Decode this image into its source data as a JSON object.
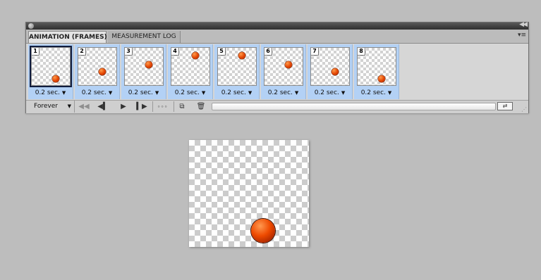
{
  "panel": {
    "tabs": [
      {
        "label": "ANIMATION (FRAMES)",
        "active": true
      },
      {
        "label": "MEASUREMENT LOG",
        "active": false
      }
    ],
    "frames": [
      {
        "number": "1",
        "delay": "0.2 sec.",
        "selected": true
      },
      {
        "number": "2",
        "delay": "0.2 sec.",
        "selected": false
      },
      {
        "number": "3",
        "delay": "0.2 sec.",
        "selected": false
      },
      {
        "number": "4",
        "delay": "0.2 sec.",
        "selected": false
      },
      {
        "number": "5",
        "delay": "0.2 sec.",
        "selected": false
      },
      {
        "number": "6",
        "delay": "0.2 sec.",
        "selected": false
      },
      {
        "number": "7",
        "delay": "0.2 sec.",
        "selected": false
      },
      {
        "number": "8",
        "delay": "0.2 sec.",
        "selected": false
      }
    ],
    "loop_option": "Forever",
    "icons": {
      "first_frame": "rewind-first-frame-icon",
      "prev_frame": "previous-frame-icon",
      "play": "play-icon",
      "next_frame": "next-frame-icon",
      "tween": "tween-icon",
      "duplicate": "duplicate-frame-icon",
      "delete": "trash-icon",
      "timeline": "convert-to-timeline-icon"
    }
  },
  "colors": {
    "frame_selected_bg": "#b3d1f5",
    "ball": "#e24200",
    "background": "#bdbdbd"
  }
}
